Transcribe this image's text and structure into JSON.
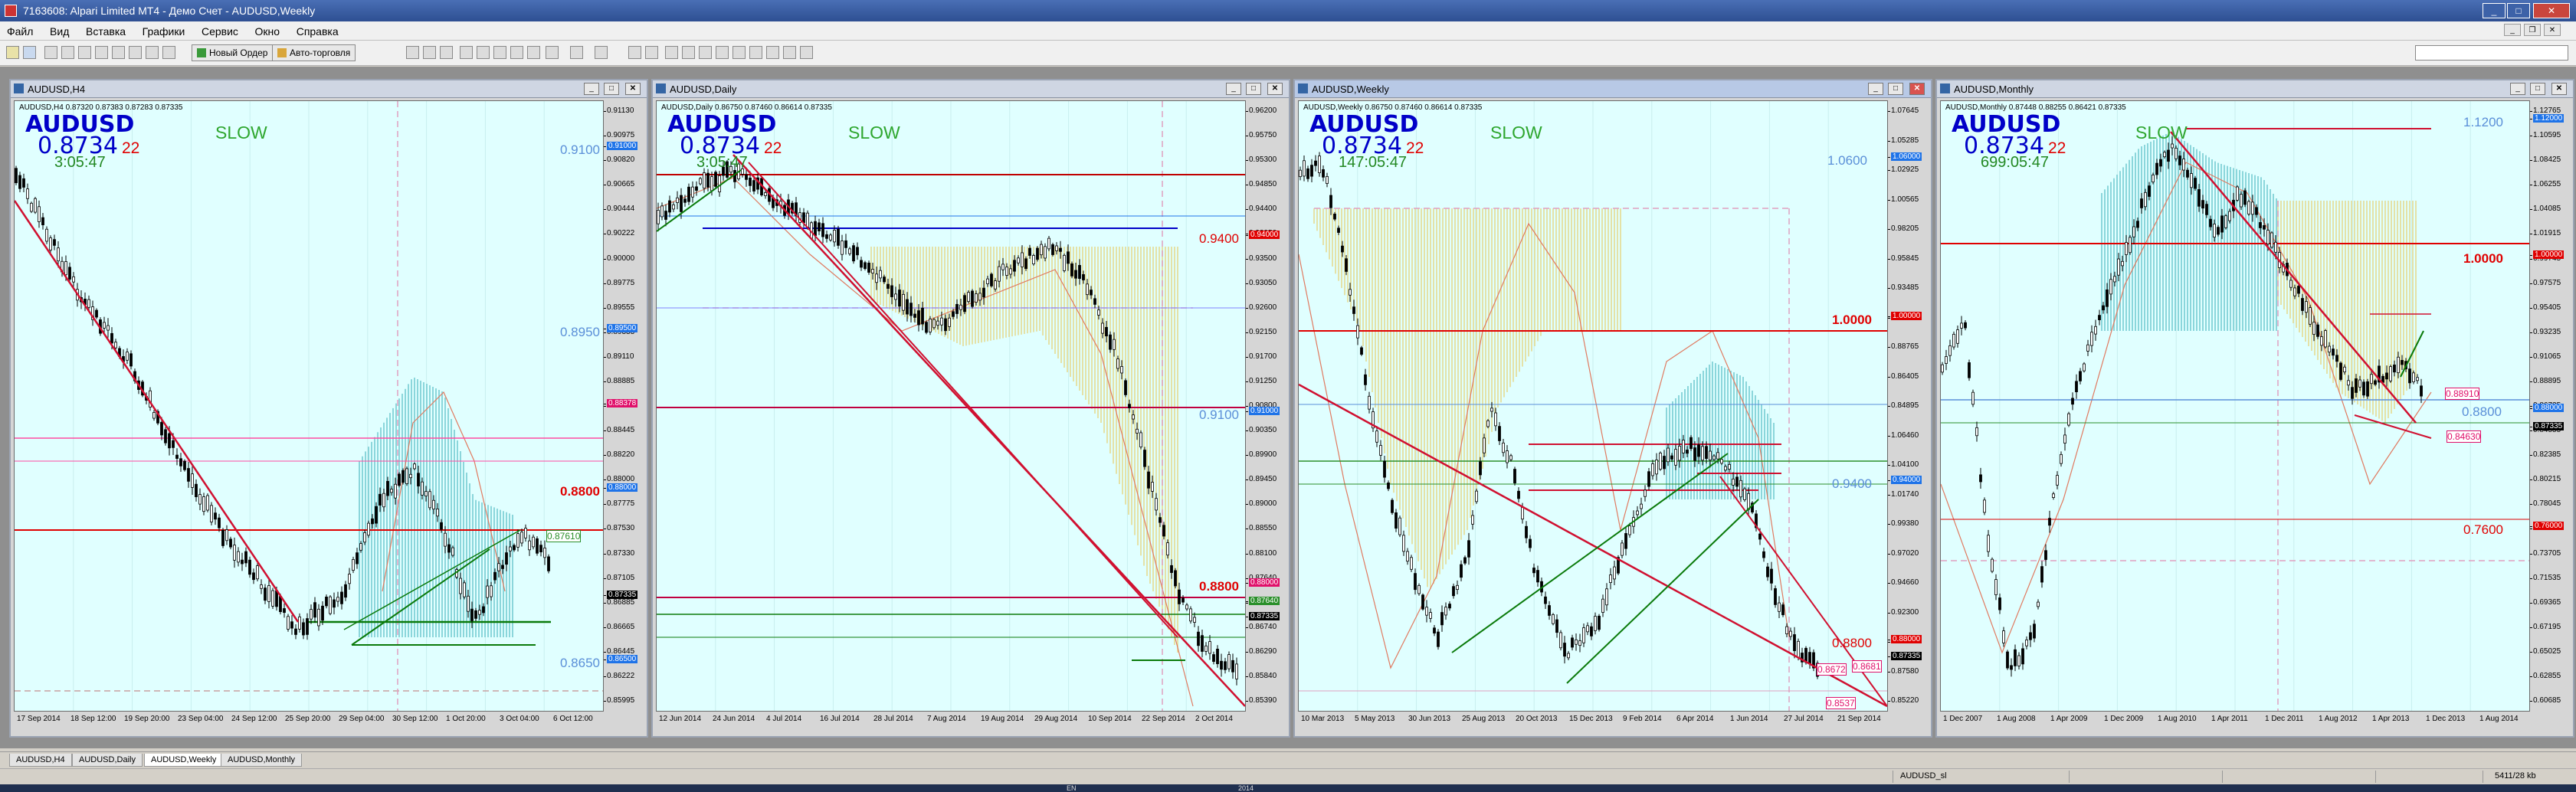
{
  "window": {
    "title": "7163608: Alpari Limited MT4 - Демо Счет - AUDUSD,Weekly",
    "controls": [
      "_",
      "□",
      "✕"
    ]
  },
  "menu": [
    "Файл",
    "Вид",
    "Вставка",
    "Графики",
    "Сервис",
    "Окно",
    "Справка"
  ],
  "toolbar": {
    "new_order": "Новый Ордер",
    "autotrading": "Авто-торговля"
  },
  "common": {
    "symbol": "AUDUSD",
    "price": "0.8734",
    "spread": "22",
    "mode": "SLOW"
  },
  "charts": [
    {
      "id": "h4",
      "title": "AUDUSD,H4",
      "ohlc": "AUDUSD,H4 0.87320 0.87383 0.87283 0.87335",
      "timer": "3:05:47",
      "levels": [
        {
          "text": "0.9100",
          "color": "#5a8fd8"
        },
        {
          "text": "0.8950",
          "color": "#5a8fd8"
        },
        {
          "text": "0.8800",
          "color": "#e00000"
        },
        {
          "text": "0.87610",
          "color": "#2a8f2a"
        },
        {
          "text": "0.8650",
          "color": "#5a8fd8"
        }
      ],
      "y_axis": [
        "0.91130",
        "0.90975",
        "0.90820",
        "0.90665",
        "0.90444",
        "0.90222",
        "0.90000",
        "0.89775",
        "0.89555",
        "0.89333",
        "0.89110",
        "0.88885",
        "0.88665",
        "0.88445",
        "0.88220",
        "0.88000",
        "0.87775",
        "0.87530",
        "0.87330",
        "0.87105",
        "0.86885",
        "0.86665",
        "0.86445",
        "0.86222",
        "0.85995"
      ],
      "tags": [
        {
          "text": "0.91000",
          "color": "#1e73e8"
        },
        {
          "text": "0.89500",
          "color": "#1e73e8"
        },
        {
          "text": "0.88378",
          "color": "#e0106a"
        },
        {
          "text": "0.88000",
          "color": "#1e73e8"
        },
        {
          "text": "0.87335",
          "color": "#000000"
        },
        {
          "text": "0.86500",
          "color": "#1e73e8"
        }
      ],
      "x_axis": [
        "17 Sep 2014",
        "18 Sep 12:00",
        "19 Sep 20:00",
        "23 Sep 04:00",
        "24 Sep 12:00",
        "25 Sep 20:00",
        "29 Sep 04:00",
        "30 Sep 12:00",
        "1 Oct 20:00",
        "3 Oct 04:00",
        "6 Oct 12:00"
      ]
    },
    {
      "id": "d1",
      "title": "AUDUSD,Daily",
      "ohlc": "AUDUSD,Daily 0.86750 0.87460 0.86614 0.87335",
      "timer": "3:05:47",
      "levels": [
        {
          "text": "0.9400",
          "color": "#e00000"
        },
        {
          "text": "0.9100",
          "color": "#5a8fd8"
        },
        {
          "text": "0.8800",
          "color": "#e00000"
        }
      ],
      "y_axis": [
        "0.96200",
        "0.95750",
        "0.95300",
        "0.94850",
        "0.94400",
        "0.93950",
        "0.93500",
        "0.93050",
        "0.92600",
        "0.92150",
        "0.91700",
        "0.91250",
        "0.90800",
        "0.90350",
        "0.89900",
        "0.89450",
        "0.89000",
        "0.88550",
        "0.88100",
        "0.87640",
        "0.87190",
        "0.86740",
        "0.86290",
        "0.85840",
        "0.85390"
      ],
      "tags": [
        {
          "text": "0.94000",
          "color": "#e00000"
        },
        {
          "text": "0.91000",
          "color": "#1e73e8"
        },
        {
          "text": "0.88000",
          "color": "#e0106a"
        },
        {
          "text": "0.87640",
          "color": "#2a8f2a"
        },
        {
          "text": "0.87335",
          "color": "#000000"
        }
      ],
      "x_axis": [
        "12 Jun 2014",
        "24 Jun 2014",
        "4 Jul 2014",
        "16 Jul 2014",
        "28 Jul 2014",
        "7 Aug 2014",
        "19 Aug 2014",
        "29 Aug 2014",
        "10 Sep 2014",
        "22 Sep 2014",
        "2 Oct 2014"
      ]
    },
    {
      "id": "w1",
      "title": "AUDUSD,Weekly",
      "ohlc": "AUDUSD,Weekly 0.86750 0.87460 0.86614 0.87335",
      "timer": "147:05:47",
      "levels": [
        {
          "text": "1.0600",
          "color": "#5a8fd8"
        },
        {
          "text": "1.0000",
          "color": "#e00000"
        },
        {
          "text": "0.9400",
          "color": "#5a8fd8"
        },
        {
          "text": "0.8800",
          "color": "#e00000"
        },
        {
          "text": "0.8681",
          "color": "#e0106a"
        },
        {
          "text": "0.8672",
          "color": "#e0106a"
        },
        {
          "text": "0.8537",
          "color": "#e0106a"
        }
      ],
      "y_axis": [
        "1.07645",
        "1.05285",
        "1.02925",
        "1.00565",
        "0.98205",
        "0.95845",
        "0.93485",
        "0.91125",
        "0.88765",
        "0.86405",
        "0.84895",
        "1.06460",
        "1.04100",
        "1.01740",
        "0.99380",
        "0.97020",
        "0.94660",
        "0.92300",
        "0.89940",
        "0.87580",
        "0.85220"
      ],
      "tags": [
        {
          "text": "1.06000",
          "color": "#1e73e8"
        },
        {
          "text": "1.00000",
          "color": "#e00000"
        },
        {
          "text": "0.94000",
          "color": "#1e73e8"
        },
        {
          "text": "0.88000",
          "color": "#e00000"
        },
        {
          "text": "0.87335",
          "color": "#000000"
        }
      ],
      "x_axis": [
        "10 Mar 2013",
        "5 May 2013",
        "30 Jun 2013",
        "25 Aug 2013",
        "20 Oct 2013",
        "15 Dec 2013",
        "9 Feb 2014",
        "6 Apr 2014",
        "1 Jun 2014",
        "27 Jul 2014",
        "21 Sep 2014"
      ]
    },
    {
      "id": "mn",
      "title": "AUDUSD,Monthly",
      "ohlc": "AUDUSD,Monthly 0.87448 0.88255 0.86421 0.87335",
      "timer": "699:05:47",
      "levels": [
        {
          "text": "1.1200",
          "color": "#5a8fd8"
        },
        {
          "text": "1.0000",
          "color": "#e00000"
        },
        {
          "text": "0.88910",
          "color": "#e0106a"
        },
        {
          "text": "0.8800",
          "color": "#5a8fd8"
        },
        {
          "text": "0.84630",
          "color": "#e0106a"
        },
        {
          "text": "0.7600",
          "color": "#e00000"
        }
      ],
      "y_axis": [
        "1.12765",
        "1.10595",
        "1.08425",
        "1.06255",
        "1.04085",
        "1.01915",
        "0.99745",
        "0.97575",
        "0.95405",
        "0.93235",
        "0.91065",
        "0.88895",
        "0.86725",
        "0.84555",
        "0.82385",
        "0.80215",
        "0.78045",
        "0.75875",
        "0.73705",
        "0.71535",
        "0.69365",
        "0.67195",
        "0.65025",
        "0.62855",
        "0.60685"
      ],
      "tags": [
        {
          "text": "1.12000",
          "color": "#1e73e8"
        },
        {
          "text": "1.00000",
          "color": "#e00000"
        },
        {
          "text": "0.88000",
          "color": "#1e73e8"
        },
        {
          "text": "0.87335",
          "color": "#000000"
        },
        {
          "text": "0.76000",
          "color": "#e00000"
        }
      ],
      "x_axis": [
        "1 Dec 2007",
        "1 Aug 2008",
        "1 Apr 2009",
        "1 Dec 2009",
        "1 Aug 2010",
        "1 Apr 2011",
        "1 Dec 2011",
        "1 Aug 2012",
        "1 Apr 2013",
        "1 Dec 2013",
        "1 Aug 2014"
      ]
    }
  ],
  "tabs": [
    "AUDUSD,H4",
    "AUDUSD,Daily",
    "AUDUSD,Weekly",
    "AUDUSD,Monthly"
  ],
  "active_tab": "AUDUSD,Weekly",
  "status": {
    "profile": "AUDUSD_sl",
    "traffic": "5411/28 kb"
  },
  "taskbar": {
    "lang": "EN",
    "time": "2014"
  }
}
